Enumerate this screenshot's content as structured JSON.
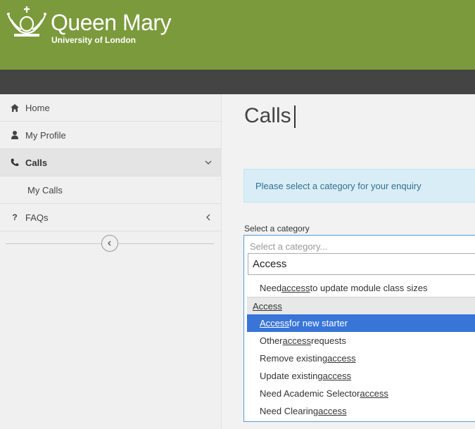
{
  "brand": {
    "name": "Queen Mary",
    "subtitle": "University of London"
  },
  "sidebar": {
    "items": [
      {
        "label": "Home",
        "icon": "home-icon"
      },
      {
        "label": "My Profile",
        "icon": "user-icon"
      },
      {
        "label": "Calls",
        "icon": "phone-icon"
      },
      {
        "label": "My Calls"
      },
      {
        "label": "FAQs",
        "icon": "question-icon"
      }
    ]
  },
  "main": {
    "title": "Calls",
    "info": "Please select a category for your enquiry",
    "field_label": "Select a category",
    "select_placeholder": "Select a category...",
    "search_value": "Access",
    "options": {
      "top": {
        "pre": "Need ",
        "match": "access",
        "post": " to update module class sizes"
      },
      "group": "Access",
      "items": [
        {
          "pre": "",
          "match": "Access",
          "post": " for new starter"
        },
        {
          "pre": "Other ",
          "match": "access",
          "post": " requests"
        },
        {
          "pre": "Remove existing ",
          "match": "access",
          "post": ""
        },
        {
          "pre": "Update existing ",
          "match": "access",
          "post": ""
        },
        {
          "pre": "Need Academic Selector ",
          "match": "access",
          "post": ""
        },
        {
          "pre": "Need Clearing ",
          "match": "access",
          "post": ""
        }
      ]
    }
  },
  "colors": {
    "header": "#7b9a3c",
    "darkbar": "#444444",
    "highlight": "#3875d7",
    "info_bg": "#d9edf7"
  }
}
